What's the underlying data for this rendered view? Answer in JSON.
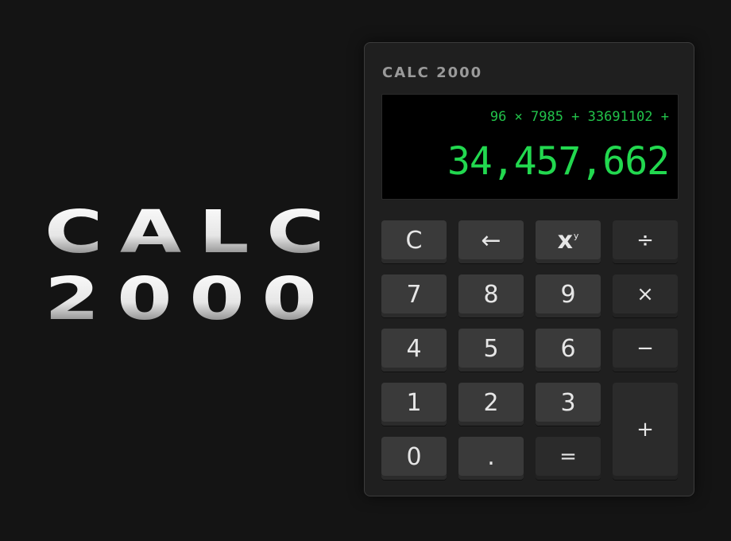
{
  "brand": {
    "line1": "CALC",
    "line2": "2000"
  },
  "calculator": {
    "title": "CALC 2000",
    "display": {
      "expression": "96 × 7985 + 33691102 +",
      "result": "34,457,662"
    },
    "keys": {
      "clear": "C",
      "backspace": "←",
      "power_base": "x",
      "power_exp": "y",
      "divide": "÷",
      "seven": "7",
      "eight": "8",
      "nine": "9",
      "multiply": "×",
      "four": "4",
      "five": "5",
      "six": "6",
      "minus": "−",
      "one": "1",
      "two": "2",
      "three": "3",
      "plus": "+",
      "zero": "0",
      "decimal": ".",
      "equals": "="
    }
  }
}
